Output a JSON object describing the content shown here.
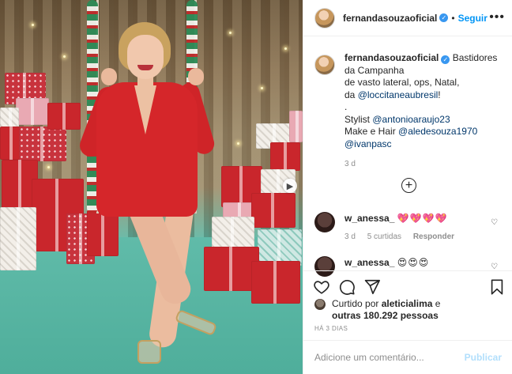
{
  "post": {
    "username": "fernandasouzaoficial",
    "follow_label": "Seguir",
    "dot": "•",
    "more_label": "•••",
    "caption": {
      "username": "fernandasouzaoficial",
      "line1": "Bastidores da Campanha",
      "line2": "de vasto lateral, ops, Natal,",
      "line3_prefix": "da",
      "line3_mention": "@loccitaneaubresil",
      "line3_suffix": "!",
      "line4": ".",
      "line5_prefix": "Stylist",
      "line5_mention": "@antonioaraujo23",
      "line6_prefix": "Make e Hair",
      "line6_mention": "@aledesouza1970",
      "line7_mention": "@ivanpasc",
      "time": "3 d"
    },
    "load_more_icon": "plus-circle-icon",
    "comments": [
      {
        "username": "w_anessa_",
        "text": "💖💖💖💖",
        "time": "3 d",
        "likes": "5 curtidas",
        "reply": "Responder"
      },
      {
        "username": "w_anessa_",
        "text": "😍😍😍",
        "time": "",
        "likes": "",
        "reply": ""
      }
    ],
    "liked_by": {
      "prefix": "Curtido por",
      "user": "aleticialima",
      "middle": "e",
      "others": "outras 180.292 pessoas"
    },
    "timestamp": "HÁ 3 DIAS",
    "add_comment": {
      "placeholder": "Adicione um comentário...",
      "publish_label": "Publicar"
    },
    "accent_color": "#0095f6",
    "icons": [
      "heart-icon",
      "comment-icon",
      "share-icon",
      "bookmark-icon",
      "verified-icon",
      "next-arrow-icon"
    ]
  }
}
